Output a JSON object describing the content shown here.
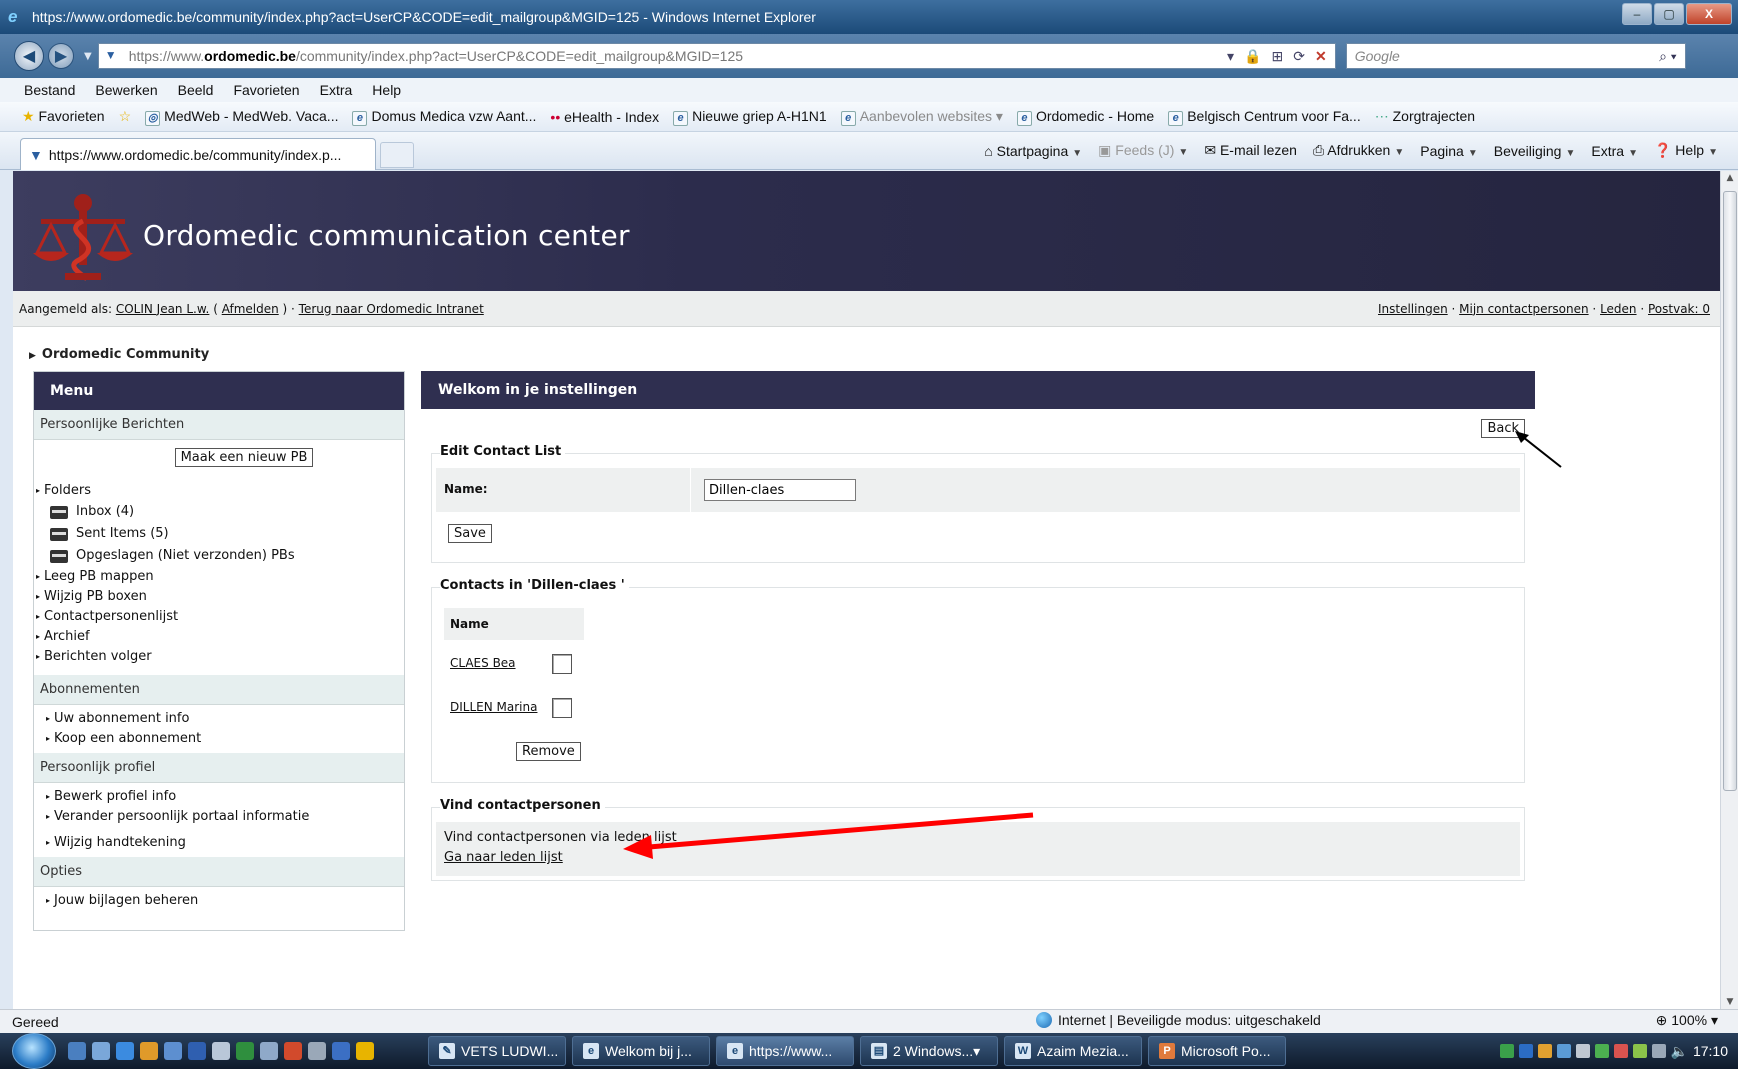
{
  "window": {
    "title": "https://www.ordomedic.be/community/index.php?act=UserCP&CODE=edit_mailgroup&MGID=125 - Windows Internet Explorer",
    "minimize": "–",
    "maximize": "▢",
    "close": "X"
  },
  "address": {
    "url_prefix": "https://www.",
    "url_domain": "ordomedic.be",
    "url_path": "/community/index.php?act=UserCP&CODE=edit_mailgroup&MGID=125",
    "search_placeholder": "Google"
  },
  "menubar": [
    "Bestand",
    "Bewerken",
    "Beeld",
    "Favorieten",
    "Extra",
    "Help"
  ],
  "favorites": {
    "label": "Favorieten",
    "items": [
      "MedWeb - MedWeb. Vaca...",
      "Domus Medica vzw  Aant...",
      "eHealth - Index",
      "Nieuwe griep A-H1N1",
      "Aanbevolen websites",
      "Ordomedic - Home",
      "Belgisch Centrum voor Fa...",
      "Zorgtrajecten"
    ]
  },
  "tabs": {
    "active_tab": "https://www.ordomedic.be/community/index.p...",
    "commands": [
      "Startpagina",
      "Feeds (J)",
      "E-mail lezen",
      "Afdrukken",
      "Pagina",
      "Beveiliging",
      "Extra",
      "Help"
    ]
  },
  "page": {
    "brand": "Ordomedic communication center",
    "userbar": {
      "logged_in_as": "Aangemeld als: ",
      "user": "COLIN Jean L.w.",
      "logout_pre": " ( ",
      "logout": "Afmelden",
      "logout_post": " ) · ",
      "back_to_intranet": "Terug naar Ordomedic Intranet",
      "settings": "Instellingen",
      "sep": " · ",
      "my_contacts": "Mijn contactpersonen",
      "members": "Leden",
      "inbox": "Postvak: 0"
    },
    "breadcrumb": "Ordomedic Community",
    "sidebar": {
      "title": "Menu",
      "pm_section": "Persoonlijke Berichten",
      "new_pm_button": "Maak een nieuw PB",
      "folders_label": "Folders",
      "folders": [
        "Inbox (4)",
        "Sent Items (5)",
        "Opgeslagen (Niet verzonden) PBs"
      ],
      "pm_links": [
        "Leeg PB mappen",
        "Wijzig PB boxen",
        "Contactpersonenlijst",
        "Archief",
        "Berichten volger"
      ],
      "subscriptions_section": "Abonnementen",
      "subscription_links": [
        "Uw abonnement info",
        "Koop een abonnement"
      ],
      "profile_section": "Persoonlijk profiel",
      "profile_links": [
        "Bewerk profiel info",
        "Verander persoonlijk portaal informatie",
        "Wijzig handtekening"
      ],
      "options_section": "Opties",
      "options_links": [
        "Jouw bijlagen beheren"
      ]
    },
    "main": {
      "title": "Welkom in je instellingen",
      "back_button": "Back",
      "edit_legend": "Edit Contact List",
      "name_label": "Name:",
      "name_value": "Dillen-claes",
      "save_button": "Save",
      "contacts_legend": "Contacts in 'Dillen-claes '",
      "contacts_header": "Name",
      "contacts": [
        "CLAES Bea",
        "DILLEN Marina"
      ],
      "remove_button": "Remove",
      "find_legend": "Vind contactpersonen",
      "find_text": "Vind contactpersonen via leden lijst",
      "find_link": "Ga naar leden lijst"
    }
  },
  "statusbar": {
    "status": "Gereed",
    "zone": "Internet | Beveiligde modus: uitgeschakeld",
    "zoom": "100%"
  },
  "taskbar": {
    "buttons": [
      "VETS LUDWI...",
      "Welkom bij j...",
      "https://www...",
      "2 Windows...",
      "Azaim Mezia...",
      "Microsoft Po..."
    ],
    "clock": "17:10"
  },
  "colors": {
    "banner": "#2c2c4c",
    "panel_head": "#2f2f50",
    "section_bg": "#e6efef",
    "annotation_arrow": "#ff0000"
  }
}
